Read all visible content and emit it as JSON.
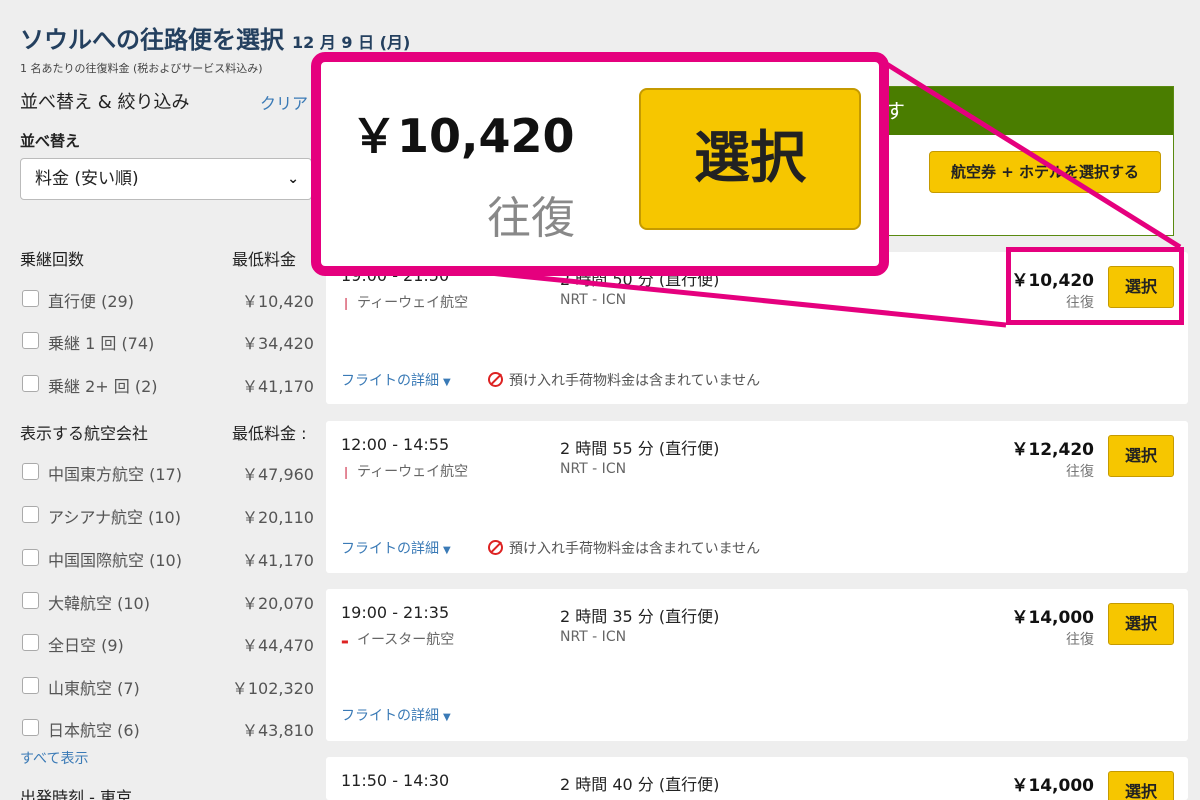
{
  "header": {
    "title": "ソウルへの往路便を選択",
    "date": "12 月 9 日 (月)",
    "subnote": "1 名あたりの往復料金 (税およびサービス料込み)"
  },
  "sidebar": {
    "sort_filter_heading": "並べ替え & 絞り込み",
    "clear_label": "クリア",
    "sort_label": "並べ替え",
    "sort_selected": "料金 (安い順)",
    "stops_heading": "乗継回数",
    "stops_price_heading": "最低料金",
    "stops": [
      {
        "name": "直行便 (29)",
        "price": "￥10,420"
      },
      {
        "name": "乗継 1 回 (74)",
        "price": "￥34,420"
      },
      {
        "name": "乗継 2+ 回 (2)",
        "price": "￥41,170"
      }
    ],
    "airlines_heading": "表示する航空会社",
    "airlines_price_heading": "最低料金 :",
    "airlines": [
      {
        "name": "中国東方航空 (17)",
        "price": "￥47,960"
      },
      {
        "name": "アシアナ航空 (10)",
        "price": "￥20,110"
      },
      {
        "name": "中国国際航空 (10)",
        "price": "￥41,170"
      },
      {
        "name": "大韓航空 (10)",
        "price": "￥20,070"
      },
      {
        "name": "全日空 (9)",
        "price": "￥44,470"
      },
      {
        "name": "山東航空 (7)",
        "price": "￥102,320"
      },
      {
        "name": "日本航空 (6)",
        "price": "￥43,810"
      }
    ],
    "show_all": "すべて表示",
    "departure_heading": "出発時刻 - 東京"
  },
  "banner": {
    "bar_text": "す",
    "button_label": "航空券 + ホテルを選択する"
  },
  "flights": [
    {
      "time": "19:00 - 21:50",
      "airline": "ティーウェイ航空",
      "duration": "2 時間 50 分 (直行便)",
      "route": "NRT - ICN",
      "price": "￥10,420",
      "trip": "往復",
      "select": "選択",
      "details": "フライトの詳細",
      "baggage": "預け入れ手荷物料金は含まれていません"
    },
    {
      "time": "12:00 - 14:55",
      "airline": "ティーウェイ航空",
      "duration": "2 時間 55 分 (直行便)",
      "route": "NRT - ICN",
      "price": "￥12,420",
      "trip": "往復",
      "select": "選択",
      "details": "フライトの詳細",
      "baggage": "預け入れ手荷物料金は含まれていません"
    },
    {
      "time": "19:00 - 21:35",
      "airline": "イースター航空",
      "duration": "2 時間 35 分 (直行便)",
      "route": "NRT - ICN",
      "price": "￥14,000",
      "trip": "往復",
      "select": "選択",
      "details": "フライトの詳細"
    },
    {
      "time": "11:50 - 14:30",
      "duration": "2 時間 40 分 (直行便)",
      "price": "￥14,000",
      "select": "選択"
    }
  ],
  "zoom": {
    "price": "￥10,420",
    "trip": "往復",
    "select": "選択"
  },
  "colors": {
    "highlight": "#e5007e",
    "select_button": "#f6c600",
    "title": "#24405f",
    "banner_green": "#4a7d00",
    "link": "#3a7ab6"
  }
}
